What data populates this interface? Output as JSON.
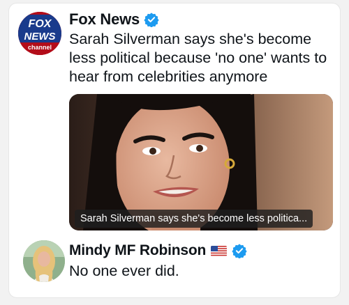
{
  "posts": [
    {
      "author": {
        "name": "Fox News",
        "verified": true,
        "avatar": {
          "logo_line1": "FOX",
          "logo_line2": "NEWS",
          "logo_line3": "channel"
        }
      },
      "text": "Sarah Silverman says she's become less political because 'no one' wants to hear from celebrities anymore",
      "media": {
        "caption": "Sarah Silverman says she's become less politica..."
      }
    },
    {
      "author": {
        "name": "Mindy MF Robinson",
        "verified": true,
        "flag": "us-flag-icon"
      },
      "text": "No one ever did."
    }
  ],
  "colors": {
    "verified_blue": "#1d9bf0",
    "fox_red": "#b30d1a",
    "fox_blue": "#1a3b8c",
    "text": "#0f1419"
  }
}
